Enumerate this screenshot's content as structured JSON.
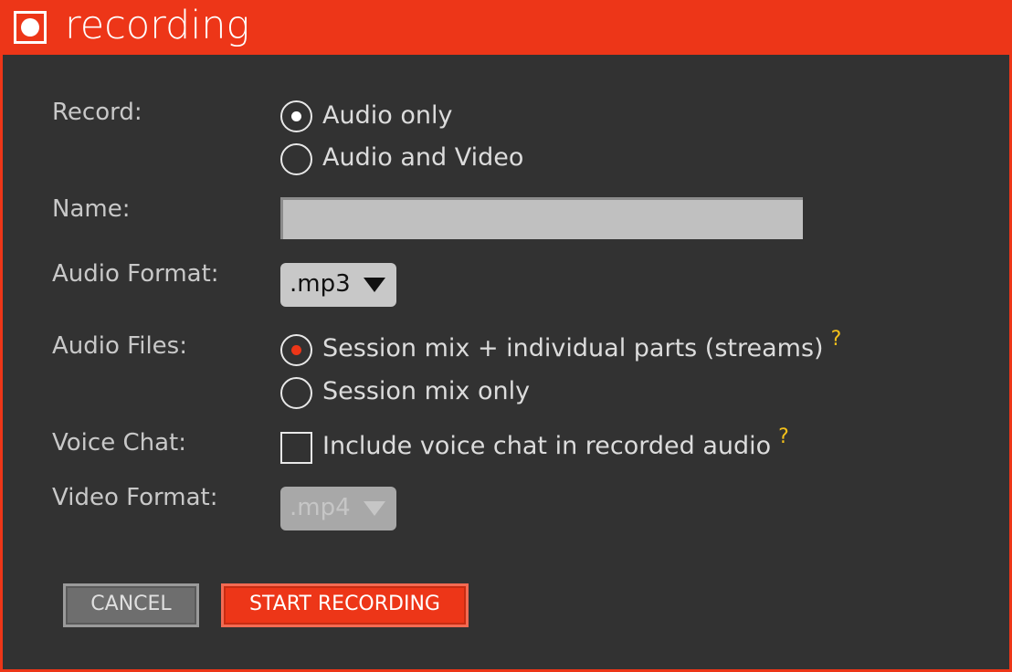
{
  "window": {
    "title": "recording",
    "accent_color": "#ed3618",
    "icon": "record-icon"
  },
  "form": {
    "record": {
      "label": "Record:",
      "options": [
        "Audio only",
        "Audio and Video"
      ],
      "selected": "Audio only"
    },
    "name": {
      "label": "Name:",
      "value": "",
      "placeholder": ""
    },
    "audio_format": {
      "label": "Audio Format:",
      "value": ".mp3"
    },
    "audio_files": {
      "label": "Audio Files:",
      "options": [
        "Session mix + individual parts (streams)",
        "Session mix only"
      ],
      "selected": "Session mix + individual parts (streams)",
      "help": "?"
    },
    "voice_chat": {
      "label": "Voice Chat:",
      "checkbox_label": "Include voice chat in recorded audio",
      "checked": false,
      "help": "?"
    },
    "video_format": {
      "label": "Video Format:",
      "value": ".mp4",
      "disabled": true
    }
  },
  "buttons": {
    "cancel": "CANCEL",
    "start": "START RECORDING"
  },
  "colors": {
    "help": "#f3c01a",
    "background": "#323232"
  }
}
